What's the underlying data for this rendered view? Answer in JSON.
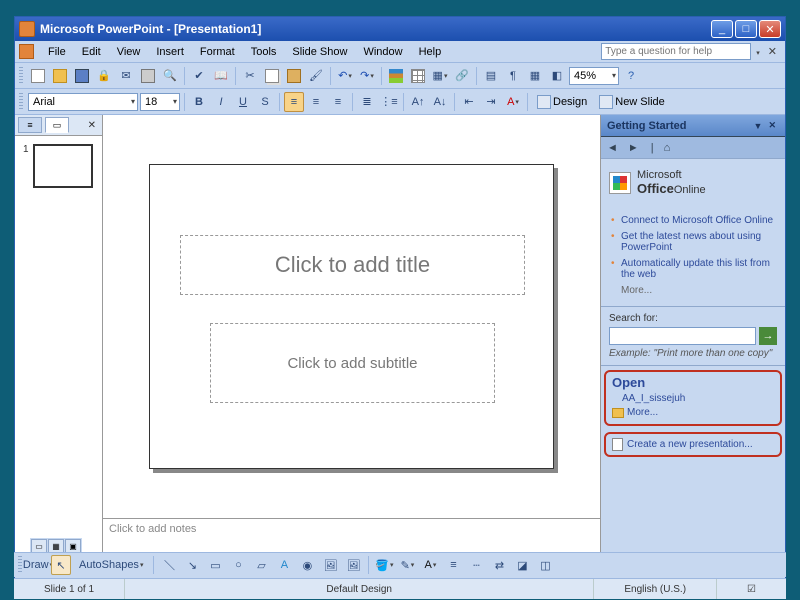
{
  "titlebar": {
    "title": "Microsoft PowerPoint - [Presentation1]"
  },
  "menu": {
    "file": "File",
    "edit": "Edit",
    "view": "View",
    "insert": "Insert",
    "format": "Format",
    "tools": "Tools",
    "slideshow": "Slide Show",
    "window": "Window",
    "help": "Help",
    "question_placeholder": "Type a question for help"
  },
  "format_toolbar": {
    "font": "Arial",
    "size": "18",
    "zoom": "45%",
    "design_label": "Design",
    "newslide_label": "New Slide"
  },
  "outline": {
    "slide_number": "1"
  },
  "slide": {
    "title_placeholder": "Click to add title",
    "subtitle_placeholder": "Click to add subtitle",
    "notes_placeholder": "Click to add notes"
  },
  "taskpane": {
    "header": "Getting Started",
    "office_online_prefix": "Microsoft",
    "office_online_brand": "Office",
    "office_online_suffix": "Online",
    "links": [
      "Connect to Microsoft Office Online",
      "Get the latest news about using PowerPoint",
      "Automatically update this list from the web"
    ],
    "more": "More...",
    "search_label": "Search for:",
    "search_example": "Example:  \"Print more than one copy\"",
    "open_header": "Open",
    "recent_file": "AA_I_sissejuh",
    "open_more": "More...",
    "create_new": "Create a new presentation..."
  },
  "drawbar": {
    "draw_label": "Draw",
    "autoshapes_label": "AutoShapes"
  },
  "status": {
    "slide": "Slide 1 of 1",
    "design": "Default Design",
    "lang": "English (U.S.)"
  }
}
